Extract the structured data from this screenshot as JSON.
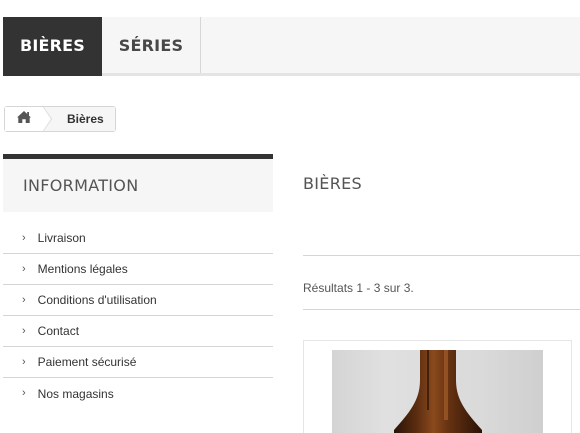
{
  "top_menu": {
    "tabs": [
      {
        "label": "BIÈRES"
      },
      {
        "label": "SÉRIES"
      }
    ]
  },
  "breadcrumb": {
    "current": "Bières"
  },
  "info_block": {
    "title": "INFORMATION",
    "items": [
      {
        "label": "Livraison"
      },
      {
        "label": "Mentions légales"
      },
      {
        "label": "Conditions d'utilisation"
      },
      {
        "label": "Contact"
      },
      {
        "label": "Paiement sécurisé"
      },
      {
        "label": "Nos magasins"
      }
    ]
  },
  "main": {
    "heading": "BIÈRES",
    "results": "Résultats 1 - 3 sur 3."
  },
  "colors": {
    "active_tab_bg": "#333333",
    "menu_bg": "#f6f6f6",
    "border": "#d6d4d4"
  }
}
